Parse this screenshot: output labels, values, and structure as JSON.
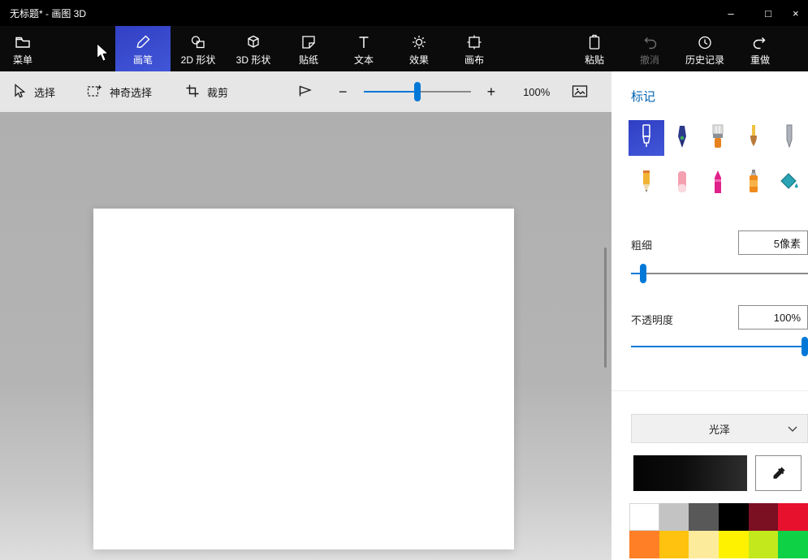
{
  "window": {
    "title": "无标题* - 画图 3D",
    "minimize_glyph": "–",
    "maximize_glyph": "□",
    "close_glyph": "×"
  },
  "toolbar": {
    "menu": "菜单",
    "brushes": "画笔",
    "shapes_2d": "2D 形状",
    "shapes_3d": "3D 形状",
    "stickers": "贴纸",
    "text": "文本",
    "effects": "效果",
    "canvas": "画布",
    "paste": "粘贴",
    "undo": "撤消",
    "history": "历史记录",
    "redo": "重做",
    "selected_tool": "画笔"
  },
  "subtoolbar": {
    "select": "选择",
    "magic_select": "神奇选择",
    "crop": "裁剪",
    "zoom_out_glyph": "−",
    "zoom_in_glyph": "+",
    "zoom_value": "100%",
    "zoom_slider_pct": 50
  },
  "panel": {
    "title": "标记",
    "brushes": [
      "marker",
      "calligraphy-pen",
      "oil-brush",
      "watercolor",
      "pixel-pen",
      "pencil",
      "eraser",
      "crayon",
      "spray-can",
      "fill"
    ],
    "selected_brush": "marker",
    "thickness_label": "粗细",
    "thickness_value": "5像素",
    "thickness_slider_pct": 5,
    "opacity_label": "不透明度",
    "opacity_value": "100%",
    "opacity_slider_pct": 100,
    "material_selected": "光泽",
    "current_color": "#000000",
    "accent_color": "#0078d7",
    "palette": [
      "#ffffff",
      "#c3c3c3",
      "#585858",
      "#000000",
      "#7a1022",
      "#e8112d",
      "#ff7f27",
      "#ffc20e",
      "#fdeb9c",
      "#fff200",
      "#c3e81c",
      "#0ed145"
    ]
  }
}
